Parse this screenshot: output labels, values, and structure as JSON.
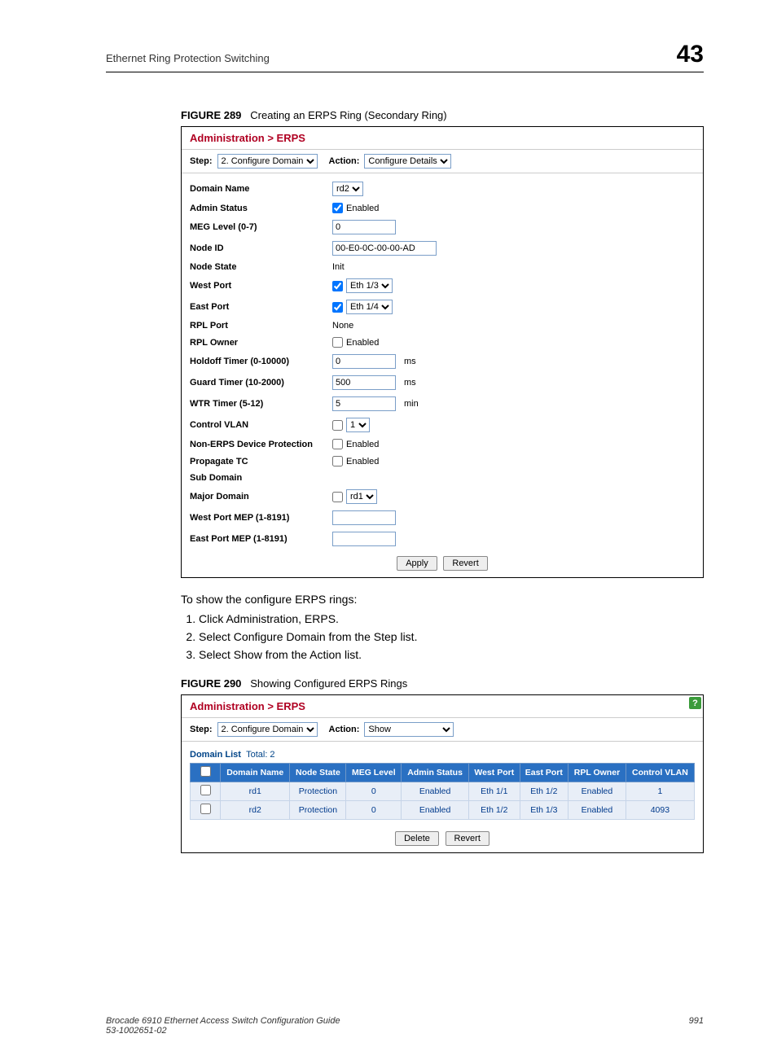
{
  "header": {
    "left": "Ethernet Ring Protection Switching",
    "right": "43"
  },
  "fig1": {
    "label": "FIGURE 289",
    "caption": "Creating an ERPS Ring (Secondary Ring)",
    "breadcrumb": "Administration > ERPS",
    "step_label": "Step:",
    "step_value": "2. Configure Domain",
    "action_label": "Action:",
    "action_value": "Configure Details",
    "rows": {
      "domain_name": {
        "label": "Domain Name",
        "value": "rd2"
      },
      "admin_status": {
        "label": "Admin Status",
        "enabled": "Enabled"
      },
      "meg_level": {
        "label": "MEG Level (0-7)",
        "value": "0"
      },
      "node_id": {
        "label": "Node ID",
        "value": "00-E0-0C-00-00-AD"
      },
      "node_state": {
        "label": "Node State",
        "value": "Init"
      },
      "west_port": {
        "label": "West Port",
        "value": "Eth 1/3"
      },
      "east_port": {
        "label": "East Port",
        "value": "Eth 1/4"
      },
      "rpl_port": {
        "label": "RPL Port",
        "value": "None"
      },
      "rpl_owner": {
        "label": "RPL Owner",
        "enabled": "Enabled"
      },
      "holdoff": {
        "label": "Holdoff Timer (0-10000)",
        "value": "0",
        "unit": "ms"
      },
      "guard": {
        "label": "Guard Timer (10-2000)",
        "value": "500",
        "unit": "ms"
      },
      "wtr": {
        "label": "WTR Timer (5-12)",
        "value": "5",
        "unit": "min"
      },
      "control_vlan": {
        "label": "Control VLAN",
        "value": "1"
      },
      "non_erps": {
        "label": "Non-ERPS Device Protection",
        "enabled": "Enabled"
      },
      "propagate_tc": {
        "label": "Propagate TC",
        "enabled": "Enabled"
      },
      "sub_domain": {
        "label": "Sub Domain"
      },
      "major_domain": {
        "label": "Major Domain",
        "value": "rd1"
      },
      "west_mep": {
        "label": "West Port MEP (1-8191)",
        "value": ""
      },
      "east_mep": {
        "label": "East Port MEP (1-8191)",
        "value": ""
      }
    },
    "buttons": {
      "apply": "Apply",
      "revert": "Revert"
    }
  },
  "body": {
    "intro": "To show the configure ERPS rings:",
    "steps": [
      "Click Administration, ERPS.",
      "Select Configure Domain from the Step list.",
      "Select Show from the Action list."
    ]
  },
  "fig2": {
    "label": "FIGURE 290",
    "caption": "Showing Configured ERPS Rings",
    "breadcrumb": "Administration > ERPS",
    "step_label": "Step:",
    "step_value": "2. Configure Domain",
    "action_label": "Action:",
    "action_value": "Show",
    "list_label": "Domain List",
    "total_label": "Total: 2",
    "columns": [
      "Domain Name",
      "Node State",
      "MEG Level",
      "Admin Status",
      "West Port",
      "East Port",
      "RPL Owner",
      "Control VLAN"
    ],
    "rows": [
      {
        "domain": "rd1",
        "state": "Protection",
        "meg": "0",
        "admin": "Enabled",
        "west": "Eth 1/1",
        "east": "Eth 1/2",
        "rpl": "Enabled",
        "vlan": "1"
      },
      {
        "domain": "rd2",
        "state": "Protection",
        "meg": "0",
        "admin": "Enabled",
        "west": "Eth 1/2",
        "east": "Eth 1/3",
        "rpl": "Enabled",
        "vlan": "4093"
      }
    ],
    "buttons": {
      "delete": "Delete",
      "revert": "Revert"
    }
  },
  "footer": {
    "left_line1": "Brocade 6910 Ethernet Access Switch Configuration Guide",
    "left_line2": "53-1002651-02",
    "right": "991"
  }
}
